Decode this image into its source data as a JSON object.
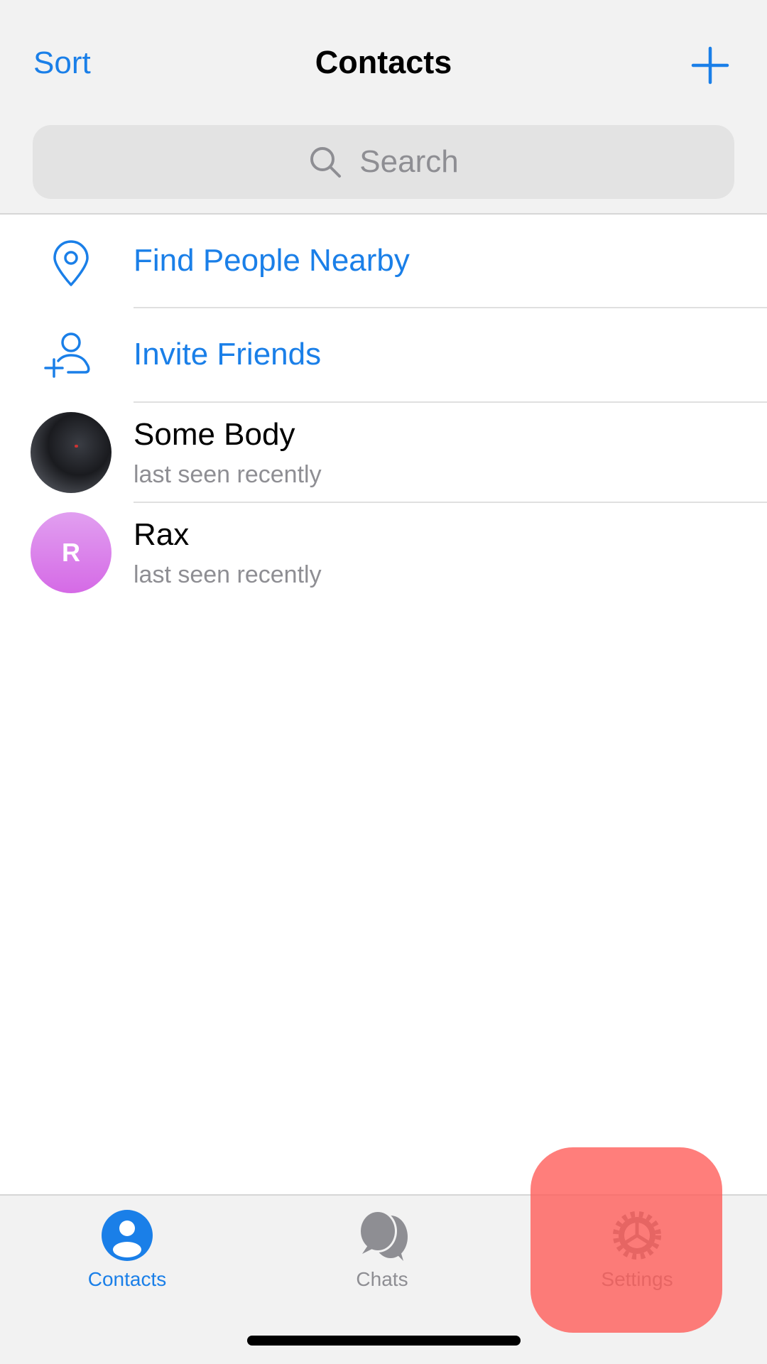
{
  "header": {
    "sort_label": "Sort",
    "title": "Contacts",
    "add_icon": "plus-icon"
  },
  "search": {
    "placeholder": "Search",
    "icon": "search-icon"
  },
  "actions": [
    {
      "label": "Find People Nearby",
      "icon": "location-pin-icon"
    },
    {
      "label": "Invite Friends",
      "icon": "add-person-icon"
    }
  ],
  "contacts": [
    {
      "name": "Some Body",
      "status": "last seen recently",
      "avatar": "photo"
    },
    {
      "name": "Rax",
      "status": "last seen recently",
      "avatar_initial": "R",
      "avatar_color": "#d56ae6"
    }
  ],
  "tabs": [
    {
      "label": "Contacts",
      "icon": "person-circle-icon",
      "active": true
    },
    {
      "label": "Chats",
      "icon": "chat-bubbles-icon",
      "active": false
    },
    {
      "label": "Settings",
      "icon": "gear-icon",
      "active": false,
      "highlighted": true
    }
  ],
  "colors": {
    "accent": "#1a7fe8",
    "inactive": "#8e8e93",
    "highlight": "#ff7b78"
  }
}
